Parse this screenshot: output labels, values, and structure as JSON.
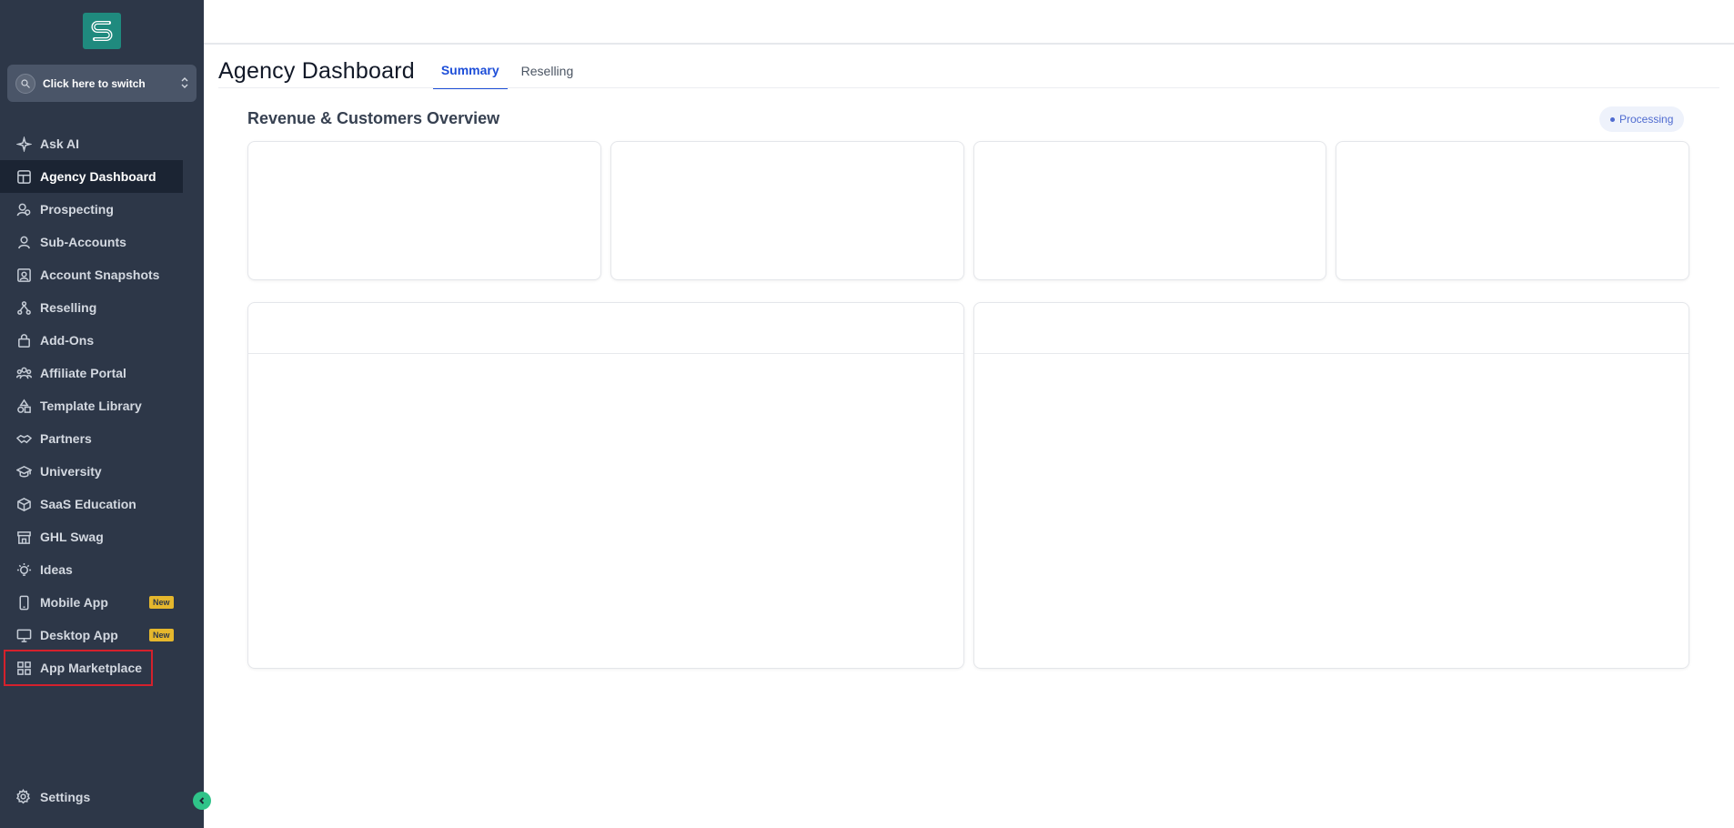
{
  "switcher": {
    "label": "Click here to switch"
  },
  "nav": {
    "items": [
      {
        "label": "Ask AI",
        "icon": "sparkle-icon"
      },
      {
        "label": "Agency Dashboard",
        "icon": "dashboard-icon",
        "active": true
      },
      {
        "label": "Prospecting",
        "icon": "prospecting-icon"
      },
      {
        "label": "Sub-Accounts",
        "icon": "user-icon"
      },
      {
        "label": "Account Snapshots",
        "icon": "snapshot-icon"
      },
      {
        "label": "Reselling",
        "icon": "reselling-icon"
      },
      {
        "label": "Add-Ons",
        "icon": "bag-icon"
      },
      {
        "label": "Affiliate Portal",
        "icon": "users-icon"
      },
      {
        "label": "Template Library",
        "icon": "shapes-icon"
      },
      {
        "label": "Partners",
        "icon": "handshake-icon"
      },
      {
        "label": "University",
        "icon": "graduation-cap-icon"
      },
      {
        "label": "SaaS Education",
        "icon": "box-icon"
      },
      {
        "label": "GHL Swag",
        "icon": "store-icon"
      },
      {
        "label": "Ideas",
        "icon": "lightbulb-icon"
      },
      {
        "label": "Mobile App",
        "icon": "phone-icon",
        "badge": "New"
      },
      {
        "label": "Desktop App",
        "icon": "monitor-icon",
        "badge": "New"
      },
      {
        "label": "App Marketplace",
        "icon": "grid-icon",
        "highlighted": true
      }
    ],
    "settings_label": "Settings"
  },
  "page": {
    "title": "Agency Dashboard",
    "tabs": [
      {
        "label": "Summary",
        "active": true
      },
      {
        "label": "Reselling"
      }
    ]
  },
  "section": {
    "title": "Revenue & Customers Overview",
    "status": "Processing"
  },
  "colors": {
    "sidebar_bg": "#2d3748",
    "accent": "#1d4ed8",
    "badge_new": "#e5b72d",
    "highlight": "#d4212c",
    "logo": "#1f8a7e"
  }
}
